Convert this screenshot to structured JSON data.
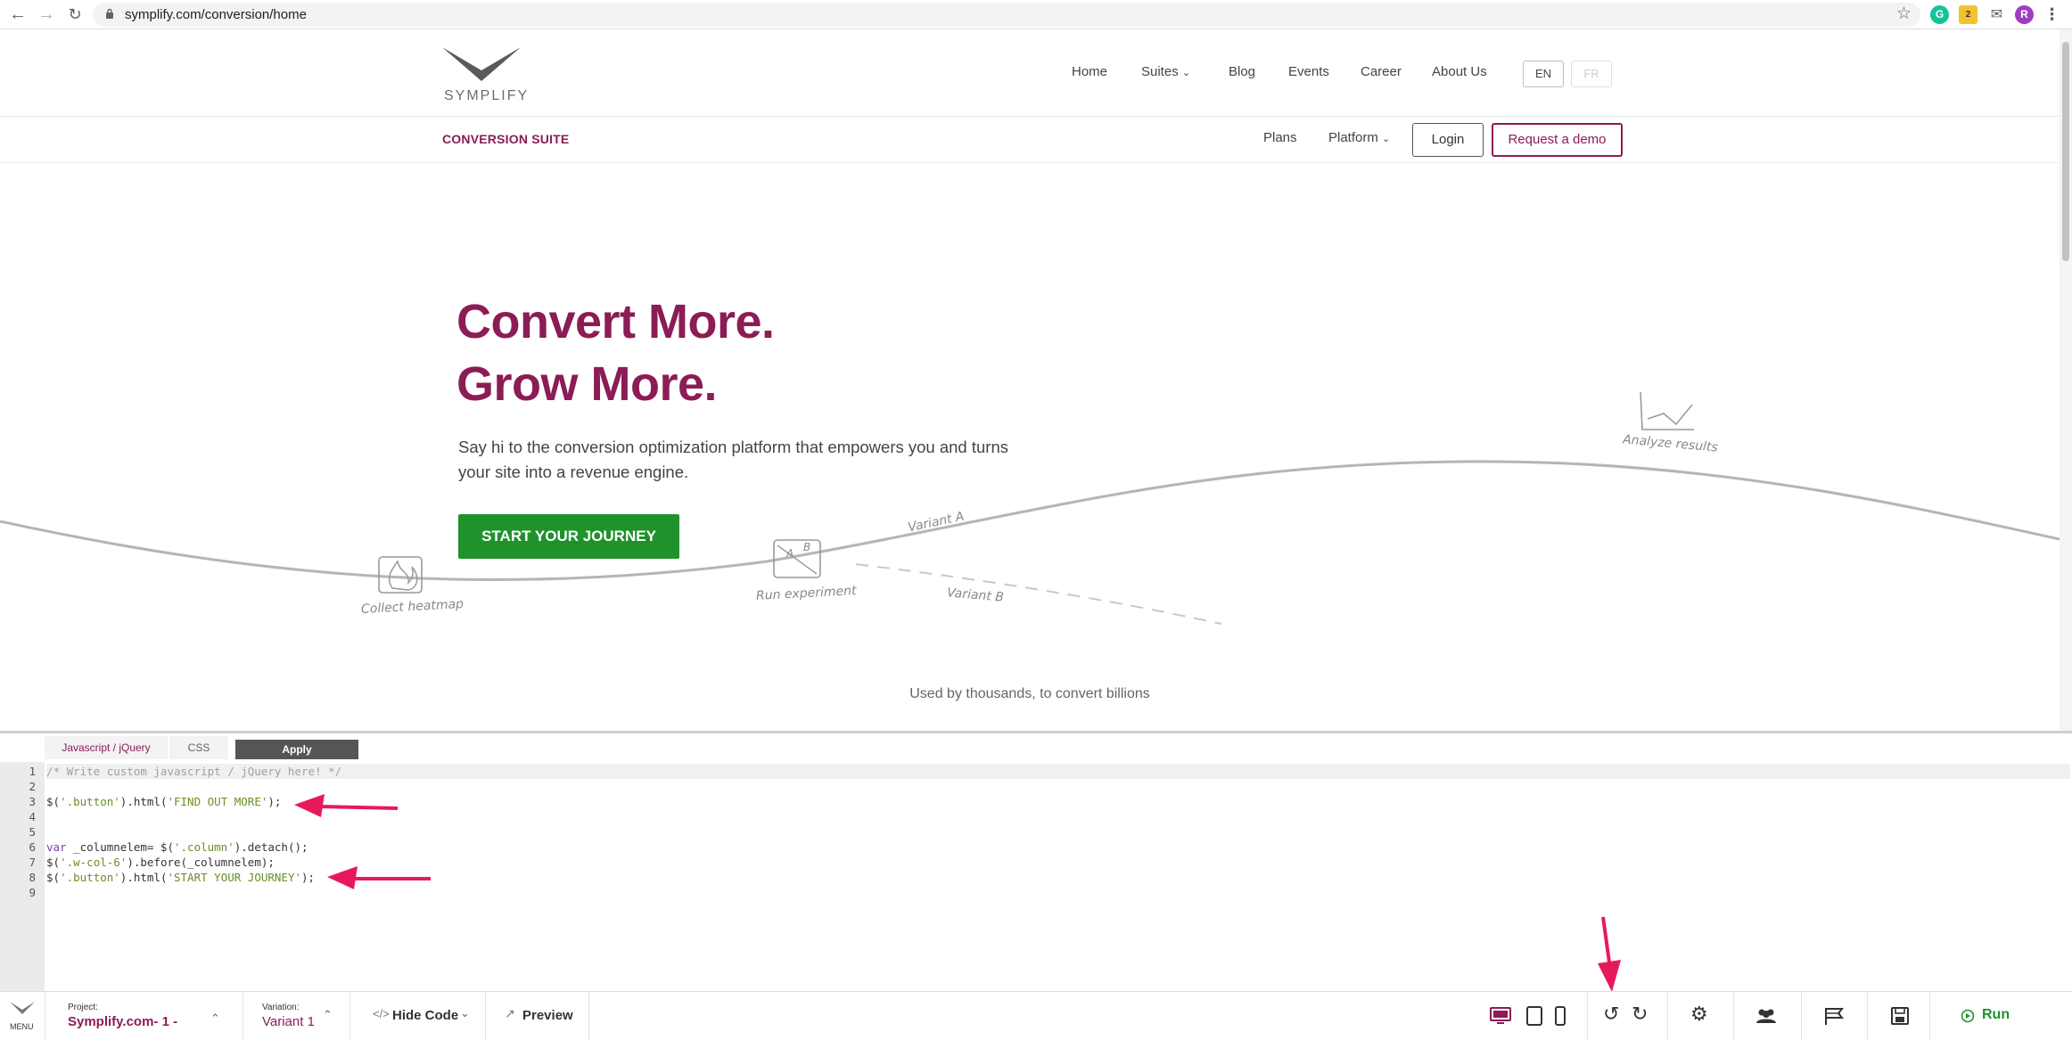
{
  "browser": {
    "url": "symplify.com/conversion/home",
    "profile_initial": "R",
    "ext_badge": "2"
  },
  "header": {
    "logo_text": "SYMPLIFY",
    "nav": [
      "Home",
      "Suites",
      "Blog",
      "Events",
      "Career",
      "About Us"
    ],
    "lang": [
      "EN",
      "FR"
    ]
  },
  "subheader": {
    "suite": "CONVERSION SUITE",
    "plans": "Plans",
    "platform": "Platform",
    "login": "Login",
    "demo": "Request a demo"
  },
  "hero": {
    "title_line1": "Convert More.",
    "title_line2": "Grow More.",
    "text": "Say hi to the conversion optimization platform that empowers you and turns your site into a revenue engine.",
    "cta": "START YOUR JOURNEY",
    "labels": {
      "heatmap": "Collect heatmap",
      "experiment": "Run experiment",
      "variant_a": "Variant A",
      "variant_b": "Variant B",
      "analyze": "Analyze results",
      "ab_a": "A",
      "ab_b": "B"
    },
    "used_by": "Used by thousands, to convert billions"
  },
  "editor": {
    "tabs": {
      "js": "Javascript / jQuery",
      "css": "CSS",
      "apply": "Apply"
    },
    "lines": [
      {
        "n": "1",
        "parts": [
          {
            "t": "/* Write custom javascript / jQuery here! */",
            "c": "c-comment"
          }
        ]
      },
      {
        "n": "2",
        "parts": []
      },
      {
        "n": "3",
        "parts": [
          {
            "t": "$(",
            "c": "c-punc"
          },
          {
            "t": "'.button'",
            "c": "c-str"
          },
          {
            "t": ").html(",
            "c": "c-punc"
          },
          {
            "t": "'FIND OUT MORE'",
            "c": "c-str"
          },
          {
            "t": ");",
            "c": "c-punc"
          }
        ]
      },
      {
        "n": "4",
        "parts": []
      },
      {
        "n": "5",
        "parts": []
      },
      {
        "n": "6",
        "parts": [
          {
            "t": "var",
            "c": "c-kw"
          },
          {
            "t": " _columnelem= $(",
            "c": "c-punc"
          },
          {
            "t": "'.column'",
            "c": "c-str"
          },
          {
            "t": ").detach();",
            "c": "c-punc"
          }
        ]
      },
      {
        "n": "7",
        "parts": [
          {
            "t": "$(",
            "c": "c-punc"
          },
          {
            "t": "'.w-col-6'",
            "c": "c-str"
          },
          {
            "t": ").before(_columnelem);",
            "c": "c-punc"
          }
        ]
      },
      {
        "n": "8",
        "parts": [
          {
            "t": "$(",
            "c": "c-punc"
          },
          {
            "t": "'.button'",
            "c": "c-str"
          },
          {
            "t": ").html(",
            "c": "c-punc"
          },
          {
            "t": "'START YOUR JOURNEY'",
            "c": "c-str"
          },
          {
            "t": ");",
            "c": "c-punc"
          }
        ]
      },
      {
        "n": "9",
        "parts": []
      }
    ]
  },
  "toolbar": {
    "menu": "MENU",
    "project_label": "Project:",
    "project_value": "Symplify.com- 1 -",
    "variation_label": "Variation:",
    "variation_value": "Variant 1",
    "hide_code": "Hide Code",
    "preview": "Preview",
    "run": "Run"
  },
  "colors": {
    "brand": "#8c1c55",
    "cta": "#1f922b",
    "arrow": "#e8195a"
  }
}
